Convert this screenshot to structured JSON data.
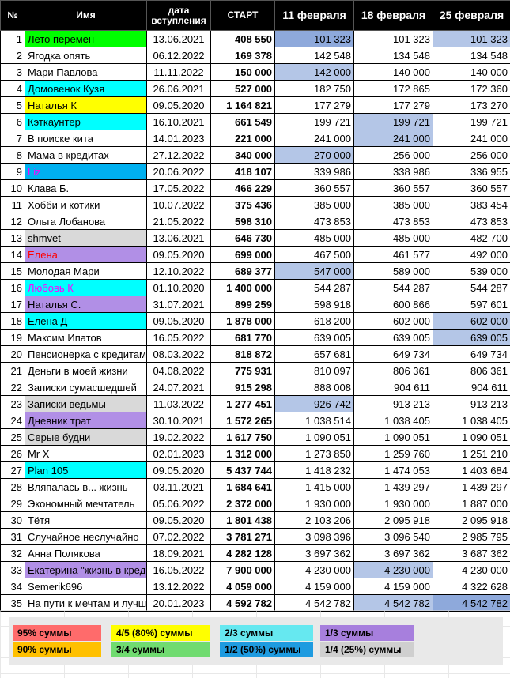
{
  "headers": [
    "№",
    "Имя",
    "дата вступления",
    "СТАРТ",
    "11 февраля",
    "18 февраля",
    "25 февраля"
  ],
  "colors": {
    "green": "#00ff00",
    "cyan": "#00ffff",
    "yellow": "#ffff00",
    "blue": "#00b0f0",
    "purple": "#b18fe6",
    "gray": "#d9d9d9",
    "highlight": "#b4c6e7",
    "highlight_dark": "#8ea9db",
    "red_text": "#ff0000",
    "magenta_text": "#ff00ff"
  },
  "rows": [
    {
      "n": "1",
      "name": "Лето перемен",
      "date": "13.06.2021",
      "start": "408 550",
      "v1": "101 323",
      "v2": "101 323",
      "v3": "101 323",
      "bg": "#00ff00",
      "h1": "#8ea9db",
      "h3": "#b4c6e7"
    },
    {
      "n": "2",
      "name": "Ягодка опять",
      "date": "06.12.2022",
      "start": "169 378",
      "v1": "142 548",
      "v2": "134 548",
      "v3": "134 548"
    },
    {
      "n": "3",
      "name": "Мари Павлова",
      "date": "11.11.2022",
      "start": "150 000",
      "v1": "142 000",
      "v2": "140 000",
      "v3": "140 000",
      "h1": "#b4c6e7"
    },
    {
      "n": "4",
      "name": "Домовенок Кузя",
      "date": "26.06.2021",
      "start": "527 000",
      "v1": "182 750",
      "v2": "172 865",
      "v3": "172 360",
      "bg": "#00ffff"
    },
    {
      "n": "5",
      "name": "Наталья К",
      "date": "09.05.2020",
      "start": "1 164 821",
      "v1": "177 279",
      "v2": "177 279",
      "v3": "173 270",
      "bg": "#ffff00"
    },
    {
      "n": "6",
      "name": "Кэткаунтер",
      "date": "16.10.2021",
      "start": "661 549",
      "v1": "199 721",
      "v2": "199 721",
      "v3": "199 721",
      "bg": "#00ffff",
      "h2": "#b4c6e7"
    },
    {
      "n": "7",
      "name": "В поиске кита",
      "date": "14.01.2023",
      "start": "221 000",
      "v1": "241 000",
      "v2": "241 000",
      "v3": "241 000",
      "h2": "#b4c6e7"
    },
    {
      "n": "8",
      "name": "Мама в кредитах",
      "date": "27.12.2022",
      "start": "340 000",
      "v1": "270 000",
      "v2": "256 000",
      "v3": "256 000",
      "h1": "#b4c6e7"
    },
    {
      "n": "9",
      "name": "Liz",
      "date": "20.06.2022",
      "start": "418 107",
      "v1": "339 986",
      "v2": "338 986",
      "v3": "336 955",
      "bg": "#00b0f0",
      "fg": "#ff00ff"
    },
    {
      "n": "10",
      "name": "Клава Б.",
      "date": "17.05.2022",
      "start": "466 229",
      "v1": "360 557",
      "v2": "360 557",
      "v3": "360 557"
    },
    {
      "n": "11",
      "name": "Хобби и котики",
      "date": "10.07.2022",
      "start": "375 436",
      "v1": "385 000",
      "v2": "385 000",
      "v3": "383 454"
    },
    {
      "n": "12",
      "name": "Ольга Лобанова",
      "date": "21.05.2022",
      "start": "598 310",
      "v1": "473 853",
      "v2": "473 853",
      "v3": "473 853"
    },
    {
      "n": "13",
      "name": "shmvet",
      "date": "13.06.2021",
      "start": "646 730",
      "v1": "485 000",
      "v2": "485 000",
      "v3": "482 700",
      "bg": "#d9d9d9"
    },
    {
      "n": "14",
      "name": "Елена",
      "date": "09.05.2020",
      "start": "699 000",
      "v1": "467 500",
      "v2": "461 577",
      "v3": "492 000",
      "bg": "#b18fe6",
      "fg": "#ff0000"
    },
    {
      "n": "15",
      "name": "Молодая Мари",
      "date": "12.10.2022",
      "start": "689 377",
      "v1": "547 000",
      "v2": "589 000",
      "v3": "539 000",
      "h1": "#b4c6e7"
    },
    {
      "n": "16",
      "name": "Любовь К",
      "date": "01.10.2020",
      "start": "1 400 000",
      "v1": "544 287",
      "v2": "544 287",
      "v3": "544 287",
      "bg": "#00ffff",
      "fg": "#ff00ff"
    },
    {
      "n": "17",
      "name": "Наталья С.",
      "date": "31.07.2021",
      "start": "899 259",
      "v1": "598 918",
      "v2": "600 866",
      "v3": "597 601",
      "bg": "#b18fe6"
    },
    {
      "n": "18",
      "name": "Елена Д",
      "date": "09.05.2020",
      "start": "1 878 000",
      "v1": "618 200",
      "v2": "602 000",
      "v3": "602 000",
      "bg": "#00ffff",
      "h3": "#b4c6e7"
    },
    {
      "n": "19",
      "name": "Максим Ипатов",
      "date": "16.05.2022",
      "start": "681 770",
      "v1": "639 005",
      "v2": "639 005",
      "v3": "639 005",
      "h3": "#b4c6e7"
    },
    {
      "n": "20",
      "name": "Пенсионерка с кредитами",
      "date": "08.03.2022",
      "start": "818 872",
      "v1": "657 681",
      "v2": "649 734",
      "v3": "649 734"
    },
    {
      "n": "21",
      "name": "Деньги в моей жизни",
      "date": "04.08.2022",
      "start": "775 931",
      "v1": "810 097",
      "v2": "806 361",
      "v3": "806 361"
    },
    {
      "n": "22",
      "name": "Записки сумасшедшей",
      "date": "24.07.2021",
      "start": "915 298",
      "v1": "888 008",
      "v2": "904 611",
      "v3": "904 611"
    },
    {
      "n": "23",
      "name": "Записки ведьмы",
      "date": "11.03.2022",
      "start": "1 277 451",
      "v1": "926 742",
      "v2": "913 213",
      "v3": "913 213",
      "bg": "#d9d9d9",
      "h1": "#b4c6e7"
    },
    {
      "n": "24",
      "name": "Дневник трат",
      "date": "30.10.2021",
      "start": "1 572 265",
      "v1": "1 038 514",
      "v2": "1 038 405",
      "v3": "1 038 405",
      "bg": "#b18fe6"
    },
    {
      "n": "25",
      "name": "Серые будни",
      "date": "19.02.2022",
      "start": "1 617 750",
      "v1": "1 090 051",
      "v2": "1 090 051",
      "v3": "1 090 051",
      "bg": "#d9d9d9"
    },
    {
      "n": "26",
      "name": "Mr X",
      "date": "02.01.2023",
      "start": "1 312 000",
      "v1": "1 273 850",
      "v2": "1 259 760",
      "v3": "1 251 210"
    },
    {
      "n": "27",
      "name": "Plan 105",
      "date": "09.05.2020",
      "start": "5 437 744",
      "v1": "1 418 232",
      "v2": "1 474 053",
      "v3": "1 403 684",
      "bg": "#00ffff"
    },
    {
      "n": "28",
      "name": "Вляпалась в... жизнь",
      "date": "03.11.2021",
      "start": "1 684 641",
      "v1": "1 415 000",
      "v2": "1 439 297",
      "v3": "1 439 297"
    },
    {
      "n": "29",
      "name": "Экономный мечтатель",
      "date": "05.06.2022",
      "start": "2 372 000",
      "v1": "1 930 000",
      "v2": "1 930 000",
      "v3": "1 887 000"
    },
    {
      "n": "30",
      "name": "Тётя",
      "date": "09.05.2020",
      "start": "1 801 438",
      "v1": "2 103 206",
      "v2": "2 095 918",
      "v3": "2 095 918"
    },
    {
      "n": "31",
      "name": "Случайное неслучайно",
      "date": "07.02.2022",
      "start": "3 781 271",
      "v1": "3 098 396",
      "v2": "3 096 540",
      "v3": "2 985 795"
    },
    {
      "n": "32",
      "name": "Анна Полякова",
      "date": "18.09.2021",
      "start": "4 282 128",
      "v1": "3 697 362",
      "v2": "3 697 362",
      "v3": "3 687 362"
    },
    {
      "n": "33",
      "name": "Екатерина \"жизнь в кредит\"",
      "date": "16.05.2022",
      "start": "7 900 000",
      "v1": "4 230 000",
      "v2": "4 230 000",
      "v3": "4 230 000",
      "bg": "#b18fe6",
      "h2": "#b4c6e7"
    },
    {
      "n": "34",
      "name": "Semerik696",
      "date": "13.12.2022",
      "start": "4 059 000",
      "v1": "4 159 000",
      "v2": "4 159 000",
      "v3": "4 322 628"
    },
    {
      "n": "35",
      "name": "На пути к мечтам и лучшему",
      "date": "20.01.2023",
      "start": "4 592 782",
      "v1": "4 542 782",
      "v2": "4 542 782",
      "v3": "4 542 782",
      "h2": "#b4c6e7",
      "h3": "#8ea9db"
    }
  ],
  "legend": {
    "l95": "95% суммы",
    "l90": "90% суммы",
    "l80": "4/5 (80%) суммы",
    "l34": "3/4 суммы",
    "l23": "2/3 суммы",
    "l12": "1/2 (50%) суммы",
    "l13": "1/3 суммы",
    "l14": "1/4 (25%) суммы"
  }
}
